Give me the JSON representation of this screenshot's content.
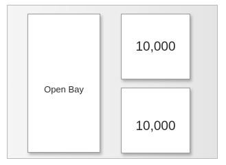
{
  "diagram": {
    "left_panel": {
      "label": "Open Bay"
    },
    "top_right_panel": {
      "label": "10,000"
    },
    "bottom_right_panel": {
      "label": "10,000"
    }
  }
}
